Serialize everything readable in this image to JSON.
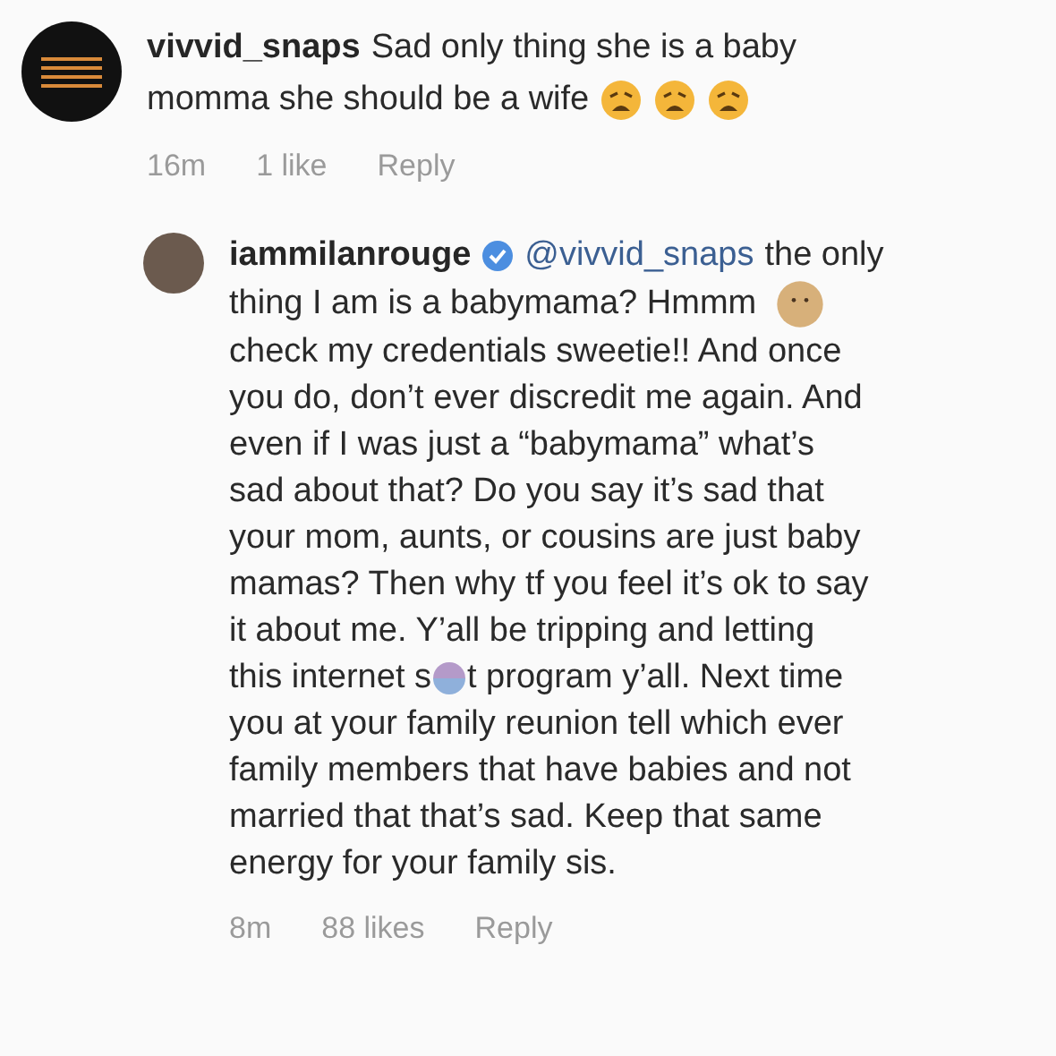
{
  "comment": {
    "username": "vivvid_snaps",
    "lines": [
      "Sad only thing she is a baby",
      "momma she should be a wife"
    ],
    "time": "16m",
    "likes": "1 like",
    "reply": "Reply"
  },
  "reply": {
    "username": "iammilanrouge",
    "verified": true,
    "mention": "@vivvid_snaps",
    "first_line": "the only",
    "lines": [
      {
        "kind": "emoji",
        "text": "thing I am is a babymama? Hmmm"
      },
      {
        "kind": "plain",
        "text": "check my credentials sweetie!! And once"
      },
      {
        "kind": "plain",
        "text": "you do, don’t ever discredit me again. And"
      },
      {
        "kind": "plain",
        "text": "even if I was just a “babymama” what’s"
      },
      {
        "kind": "plain",
        "text": "sad about that? Do you say it’s sad that"
      },
      {
        "kind": "plain",
        "text": "your mom, aunts, or cousins are just baby"
      },
      {
        "kind": "plain",
        "text": "mamas? Then why tf you feel it’s ok to say"
      },
      {
        "kind": "plain",
        "text": "it about me. Y’all be tripping and letting"
      },
      {
        "kind": "censored",
        "text": "this internet s",
        "text_after": "t program y’all. Next time"
      },
      {
        "kind": "plain",
        "text": "you at your family reunion tell which ever"
      },
      {
        "kind": "plain",
        "text": "family members that have babies and not"
      },
      {
        "kind": "plain",
        "text": "married that that’s sad. Keep that same"
      },
      {
        "kind": "plain",
        "text": "energy for your family sis."
      }
    ],
    "time": "8m",
    "likes": "88 likes",
    "reply": "Reply"
  }
}
